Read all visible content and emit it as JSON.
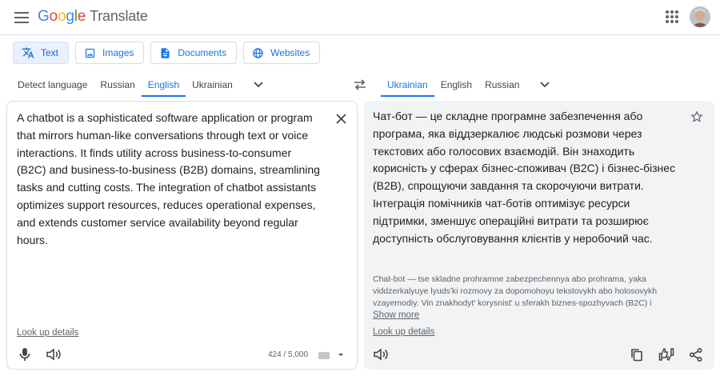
{
  "header": {
    "logo_google": "Google",
    "logo_product": "Translate",
    "menu_icon": "hamburger-menu-icon",
    "apps_icon": "apps-grid-icon"
  },
  "modes": [
    {
      "label": "Text",
      "icon": "translate-icon",
      "active": true
    },
    {
      "label": "Images",
      "icon": "image-icon",
      "active": false
    },
    {
      "label": "Documents",
      "icon": "document-icon",
      "active": false
    },
    {
      "label": "Websites",
      "icon": "globe-icon",
      "active": false
    }
  ],
  "source_langs": [
    "Detect language",
    "Russian",
    "English",
    "Ukrainian"
  ],
  "source_active": "English",
  "target_langs": [
    "Ukrainian",
    "English",
    "Russian"
  ],
  "target_active": "Ukrainian",
  "source": {
    "text": "A chatbot is a sophisticated software application or program that mirrors human-like conversations through text or voice interactions. It finds utility across business-to-consumer (B2C) and business-to-business (B2B) domains, streamlining tasks and cutting costs. The integration of chatbot assistants optimizes support resources, reduces operational expenses, and extends customer service availability beyond regular hours.",
    "lookup": "Look up details",
    "char_count": "424 / 5,000"
  },
  "target": {
    "text": "Чат-бот — це складне програмне забезпечення або програма, яка віддзеркалює людські розмови через текстових або голосових взаємодій. Він знаходить корисність у сферах бізнес-споживач (B2C) і бізнес-бізнес (B2B), спрощуючи завдання та скорочуючи витрати. Інтеграція помічників чат-ботів оптимізує ресурси підтримки, зменшує операційні витрати та розширює доступність обслуговування клієнтів у неробочий час.",
    "transliteration": "Chat-bot — tse skladne prohramne zabezpechennya abo prohrama, yaka viddzerkalyuye lyuds'ki rozmovy za dopomohoyu tekstovykh abo holosovykh vzayemodiy. Vin znakhodyt' korysnist' u sferakh biznes-spozhyvach (B2C) i",
    "show_more": "Show more",
    "lookup": "Look up details"
  },
  "colors": {
    "accent": "#1a73e8",
    "target_bg": "#f1f3f4",
    "border": "#dadce0"
  }
}
